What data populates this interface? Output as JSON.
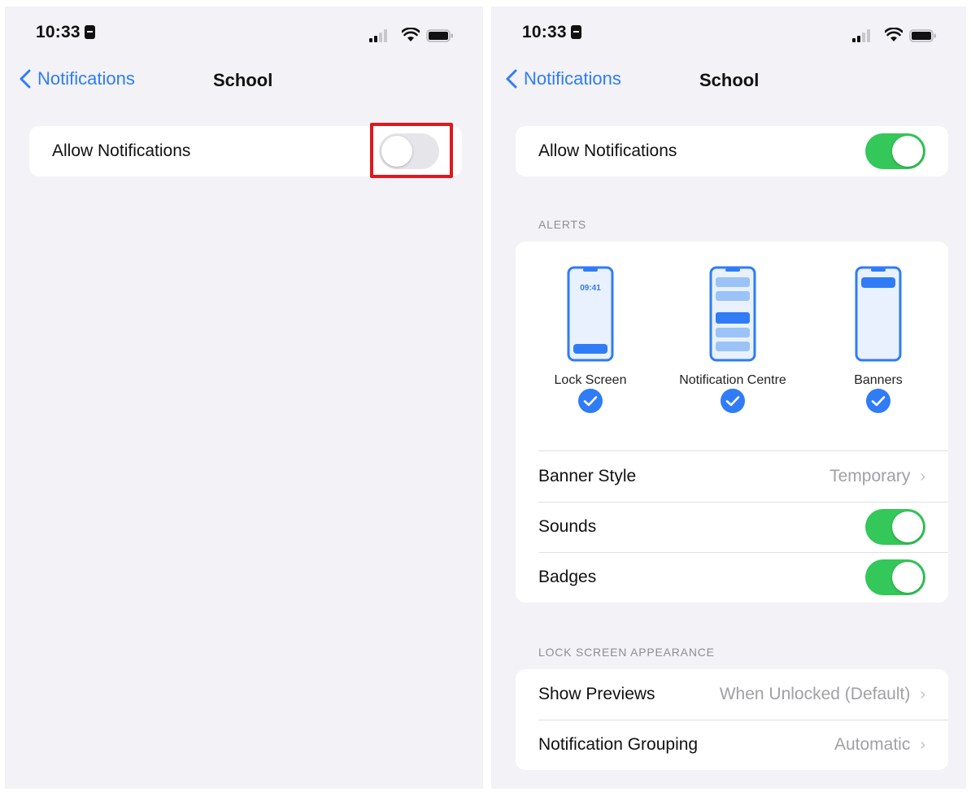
{
  "left_screen": {
    "status": {
      "time": "10:33"
    },
    "nav": {
      "back_label": "Notifications",
      "title": "School"
    },
    "allow_notifications": {
      "label": "Allow Notifications",
      "enabled": false
    }
  },
  "right_screen": {
    "status": {
      "time": "10:33"
    },
    "nav": {
      "back_label": "Notifications",
      "title": "School"
    },
    "allow_notifications": {
      "label": "Allow Notifications",
      "enabled": true
    },
    "alerts": {
      "header": "ALERTS",
      "options": [
        {
          "label": "Lock Screen",
          "preview_time": "09:41",
          "checked": true
        },
        {
          "label": "Notification Centre",
          "checked": true
        },
        {
          "label": "Banners",
          "checked": true
        }
      ],
      "banner_style": {
        "label": "Banner Style",
        "value": "Temporary"
      },
      "sounds": {
        "label": "Sounds",
        "enabled": true
      },
      "badges": {
        "label": "Badges",
        "enabled": true
      }
    },
    "lock_screen_appearance": {
      "header": "LOCK SCREEN APPEARANCE",
      "show_previews": {
        "label": "Show Previews",
        "value": "When Unlocked (Default)"
      },
      "notification_grouping": {
        "label": "Notification Grouping",
        "value": "Automatic"
      }
    }
  },
  "colors": {
    "accent": "#2f7cf6",
    "toggle_on": "#34c759",
    "toggle_off": "#e6e6ea",
    "highlight": "#e0181c",
    "background": "#f2f2f7"
  },
  "icons": [
    "chevron-left-icon",
    "chevron-right-icon",
    "signal-icon",
    "wifi-icon",
    "battery-icon",
    "checkmark-icon",
    "phone-lock-screen-icon",
    "phone-notification-centre-icon",
    "phone-banners-icon"
  ]
}
